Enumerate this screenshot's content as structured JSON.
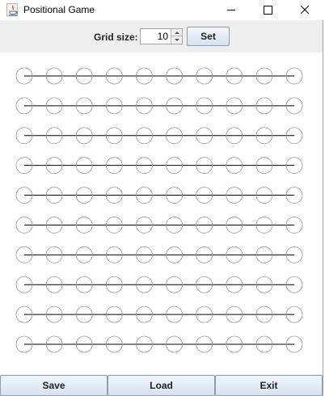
{
  "window": {
    "title": "Positional Game",
    "controls": [
      "minimize-icon",
      "maximize-icon",
      "close-icon"
    ]
  },
  "config_panel": {
    "grid_size_label": "Grid size:",
    "grid_size_value": "10",
    "set_label": "Set"
  },
  "board": {
    "rows": 10,
    "cols": 10,
    "line_color": "#000000",
    "dot_stroke": "#9a9a9a"
  },
  "control_panel": {
    "save_label": "Save",
    "load_label": "Load",
    "exit_label": "Exit"
  }
}
